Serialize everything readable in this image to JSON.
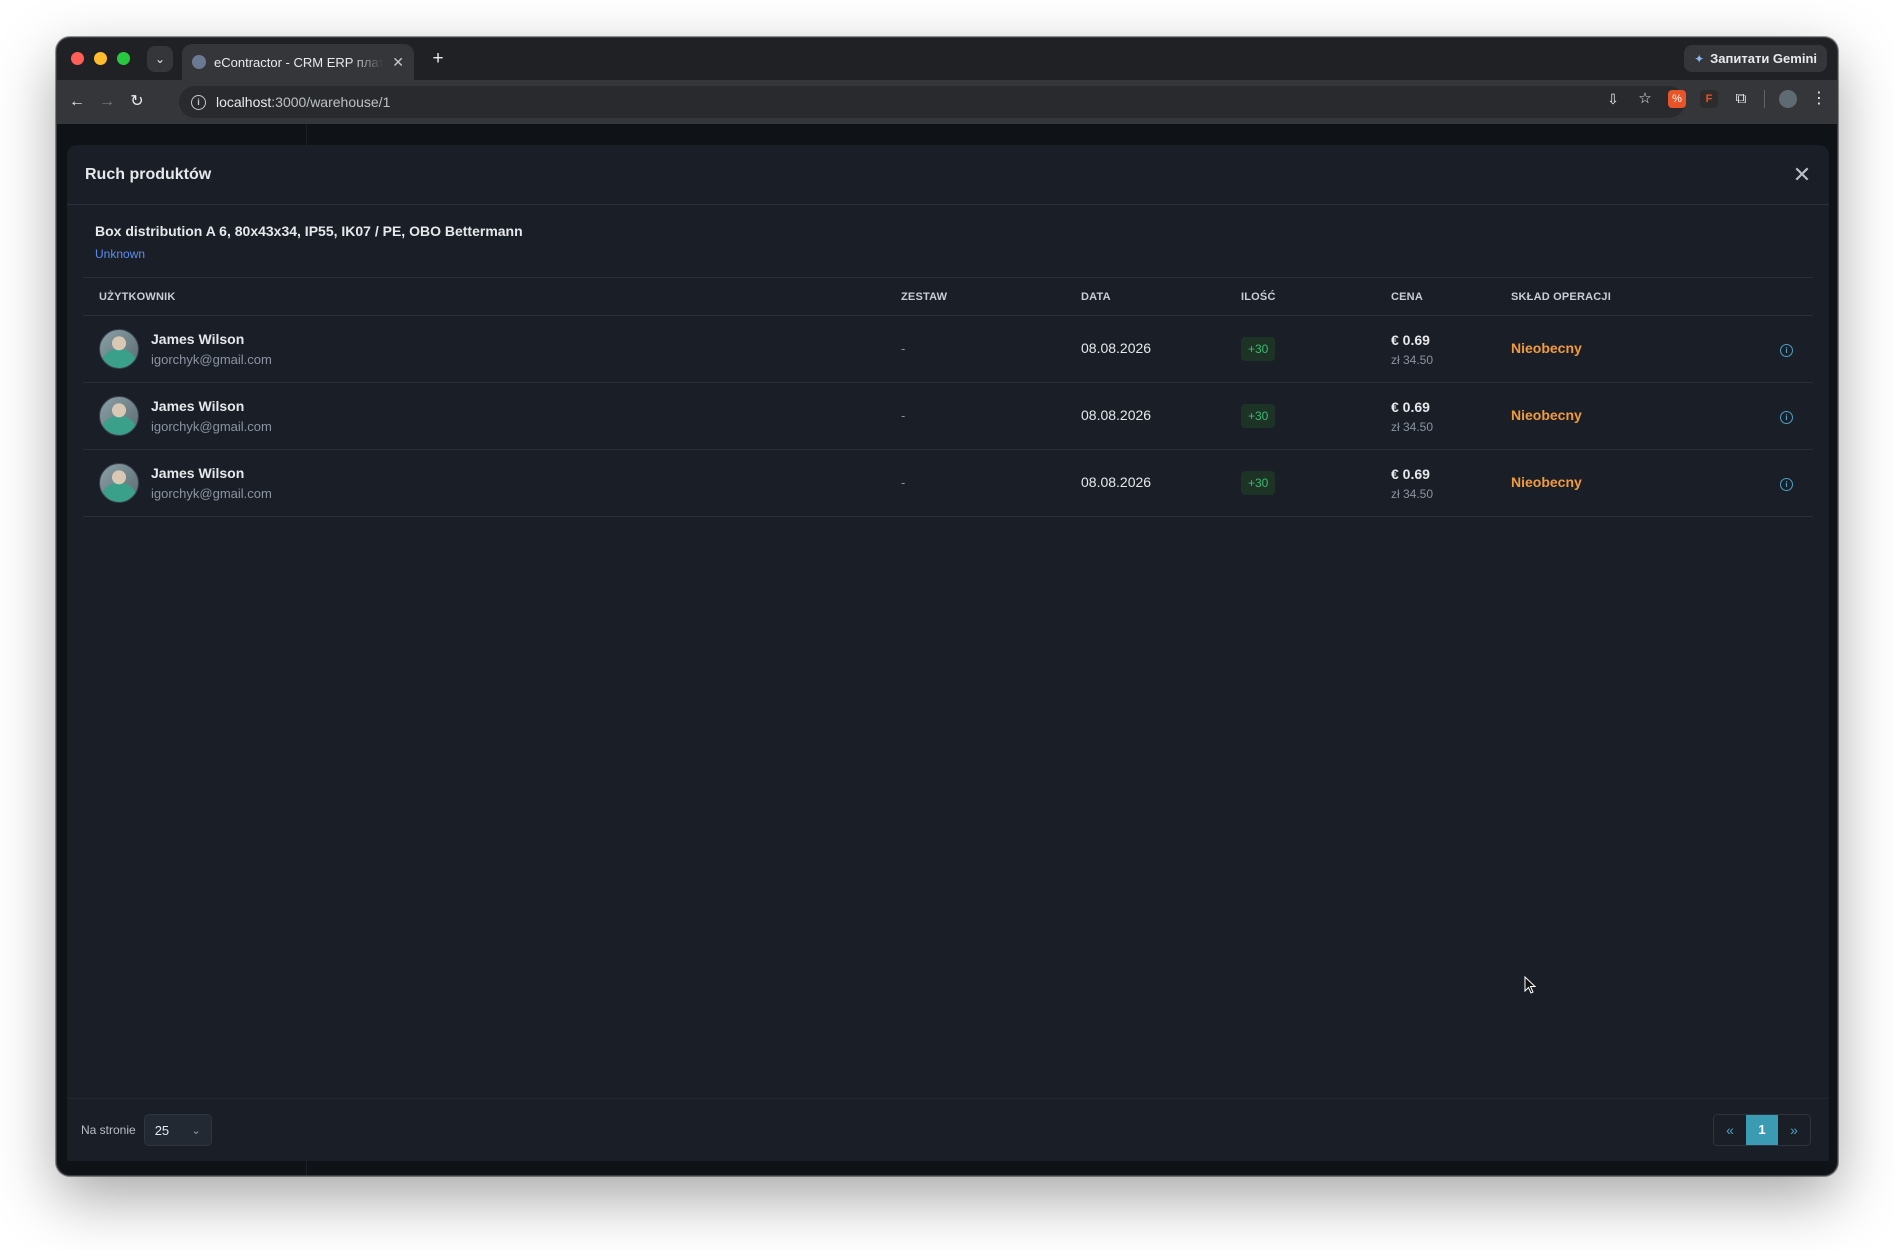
{
  "browser": {
    "tab_title": "eContractor - CRM ERP плат",
    "gemini_label": "Запитати Gemini",
    "url_host": "localhost",
    "url_path": ":3000/warehouse/1"
  },
  "modal": {
    "title": "Ruch produktów",
    "product_name": "Box distribution A 6, 80x43x34, IP55, IK07 / PE, OBO Bettermann",
    "product_sub": "Unknown",
    "columns": {
      "user": "UŻYTKOWNIK",
      "set": "ZESTAW",
      "date": "DATA",
      "qty": "ILOŚĆ",
      "price": "CENA",
      "store": "SKŁAD OPERACJI"
    },
    "rows": [
      {
        "name": "James Wilson",
        "email": "igorchyk@gmail.com",
        "set": "-",
        "date": "08.08.2026",
        "qty": "+30",
        "price": "€ 0.69",
        "price_sub": "zł 34.50",
        "store": "Nieobecny"
      },
      {
        "name": "James Wilson",
        "email": "igorchyk@gmail.com",
        "set": "-",
        "date": "08.08.2026",
        "qty": "+30",
        "price": "€ 0.69",
        "price_sub": "zł 34.50",
        "store": "Nieobecny"
      },
      {
        "name": "James Wilson",
        "email": "igorchyk@gmail.com",
        "set": "-",
        "date": "08.08.2026",
        "qty": "+30",
        "price": "€ 0.69",
        "price_sub": "zł 34.50",
        "store": "Nieobecny"
      }
    ],
    "footer": {
      "per_page_label": "Na stronie",
      "per_page_value": "25",
      "pager_prev": "«",
      "pager_current": "1",
      "pager_next": "»"
    }
  },
  "colors": {
    "accent": "#3a9bb3",
    "store_status": "#f19a3e",
    "qty_positive": "#3fb871",
    "link": "#5b8def"
  }
}
